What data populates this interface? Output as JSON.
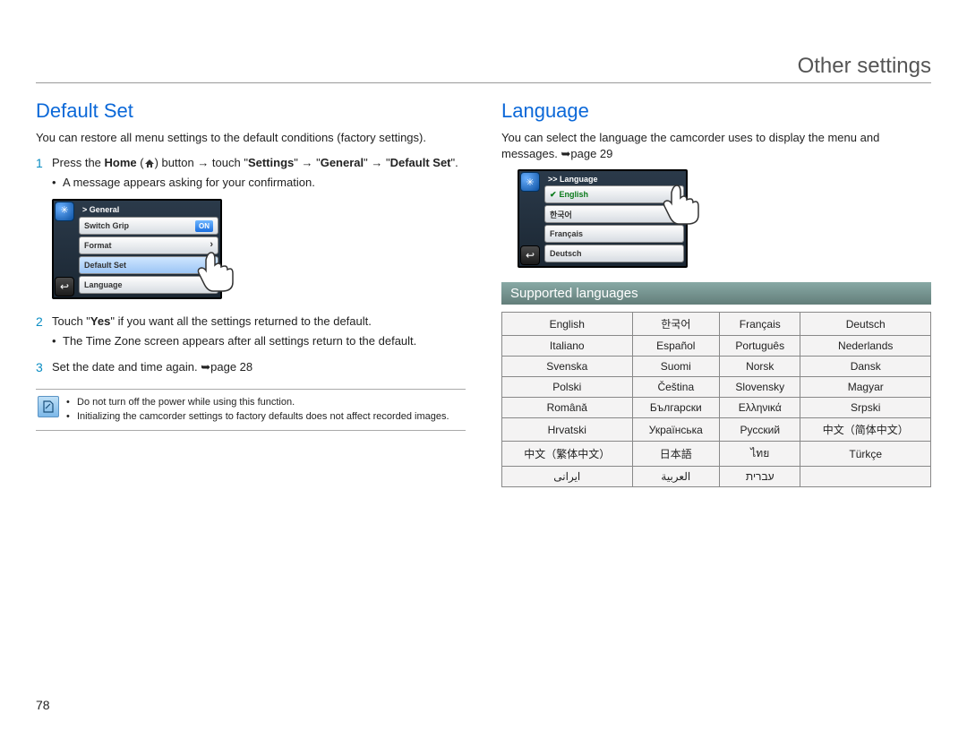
{
  "doc": {
    "page_title": "Other settings",
    "page_number": "78"
  },
  "left": {
    "heading": "Default Set",
    "intro": "You can restore all menu settings to the default conditions (factory settings).",
    "step1_a": "Press the ",
    "step1_home": "Home",
    "step1_b": " (",
    "step1_c": ") button ",
    "step1_d": " touch \"",
    "step1_settings": "Settings",
    "step1_e": "\" ",
    "step1_f": " \"",
    "step1_general": "General",
    "step1_g": "\" ",
    "step1_h": " \"",
    "step1_default": "Default Set",
    "step1_i": "\".",
    "step1_bullet": "A message appears asking for your confirmation.",
    "lcd1": {
      "breadcrumb": "> General",
      "rows": [
        {
          "label": "Switch Grip",
          "badge": "ON"
        },
        {
          "label": "Format",
          "chev": true
        },
        {
          "label": "Default Set",
          "chev": true,
          "selected": true
        },
        {
          "label": "Language",
          "chev": true
        }
      ]
    },
    "step2_a": "Touch \"",
    "step2_yes": "Yes",
    "step2_b": "\" if you want all the settings returned to the default.",
    "step2_bullet": "The Time Zone screen appears after all settings return to the default.",
    "step3_a": "Set the date and time again. ",
    "step3_b": "page 28",
    "notes": [
      "Do not turn off the power while using this function.",
      "Initializing the camcorder settings to factory defaults does not affect recorded images."
    ]
  },
  "right": {
    "heading": "Language",
    "intro_a": "You can select the language the camcorder uses to display the menu and messages. ",
    "intro_b": "page 29",
    "lcd2": {
      "breadcrumb": ">> Language",
      "rows": [
        {
          "label": "English",
          "green": true
        },
        {
          "label": "한국어"
        },
        {
          "label": "Français"
        },
        {
          "label": "Deutsch"
        }
      ]
    },
    "sup_heading": "Supported languages",
    "languages": [
      [
        "English",
        "한국어",
        "Français",
        "Deutsch"
      ],
      [
        "Italiano",
        "Español",
        "Português",
        "Nederlands"
      ],
      [
        "Svenska",
        "Suomi",
        "Norsk",
        "Dansk"
      ],
      [
        "Polski",
        "Čeština",
        "Slovensky",
        "Magyar"
      ],
      [
        "Română",
        "Български",
        "Ελληνικά",
        "Srpski"
      ],
      [
        "Hrvatski",
        "Українська",
        "Русский",
        "中文（简体中文）"
      ],
      [
        "中文（繁体中文）",
        "日本語",
        "ไทย",
        "Türkçe"
      ],
      [
        "ایرانی",
        "العربية",
        "עברית",
        ""
      ]
    ]
  }
}
